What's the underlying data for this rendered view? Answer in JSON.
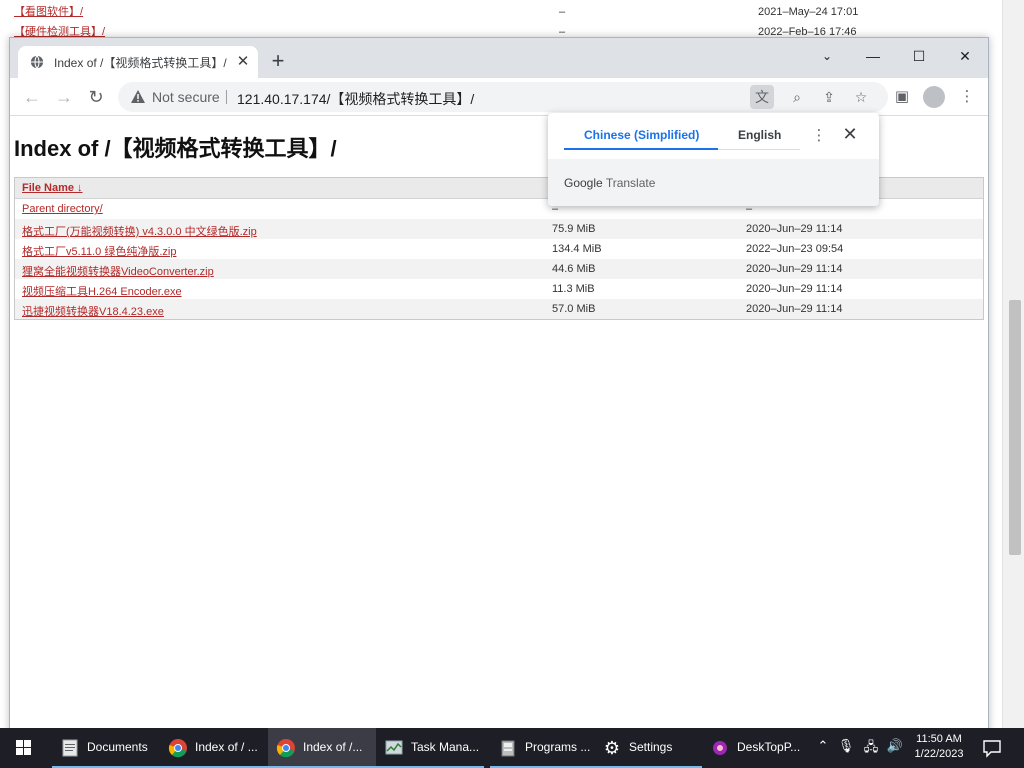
{
  "background_listing": [
    {
      "name": "【看图软件】/",
      "size": "–",
      "date": "2021–May–24 17:01"
    },
    {
      "name": "【硬件检测工具】/",
      "size": "–",
      "date": "2022–Feb–16 17:46"
    }
  ],
  "browser": {
    "tab_title": "Index of /【视频格式转换工具】/",
    "security_label": "Not secure",
    "url": "121.40.17.174/【视频格式转换工具】/"
  },
  "page": {
    "title": "Index of /【视频格式转换工具】/",
    "header": {
      "name": "File Name",
      "sort_arrow": "↓"
    },
    "rows": [
      {
        "name": "Parent directory/",
        "size": "–",
        "date": "–"
      },
      {
        "name": "格式工厂(万能视频转换) v4.3.0.0 中文绿色版.zip",
        "size": "75.9 MiB",
        "date": "2020–Jun–29 11:14"
      },
      {
        "name": "格式工厂v5.11.0 绿色纯净版.zip",
        "size": "134.4 MiB",
        "date": "2022–Jun–23 09:54"
      },
      {
        "name": "狸窝全能视频转换器VideoConverter.zip",
        "size": "44.6 MiB",
        "date": "2020–Jun–29 11:14"
      },
      {
        "name": "视频压缩工具H.264 Encoder.exe",
        "size": "11.3 MiB",
        "date": "2020–Jun–29 11:14"
      },
      {
        "name": "迅捷视频转换器V18.4.23.exe",
        "size": "57.0 MiB",
        "date": "2020–Jun–29 11:14"
      }
    ]
  },
  "translate_popup": {
    "source_language": "Chinese (Simplified)",
    "target_language": "English",
    "brand_google": "Google",
    "brand_translate": "Translate"
  },
  "taskbar": {
    "items": [
      {
        "label": "Documents"
      },
      {
        "label": "Index of / ..."
      },
      {
        "label": "Index of /..."
      },
      {
        "label": "Task Mana..."
      },
      {
        "label": "Programs ..."
      },
      {
        "label": "Settings"
      },
      {
        "label": "DeskTopP..."
      }
    ],
    "time": "11:50 AM",
    "date": "1/22/2023"
  },
  "colors": {
    "link": "#b32a2a",
    "accent": "#1a73e8",
    "taskbar": "#1d1e26",
    "taskbar_active": "#3b3c45",
    "tabstrip": "#dee1e6"
  }
}
